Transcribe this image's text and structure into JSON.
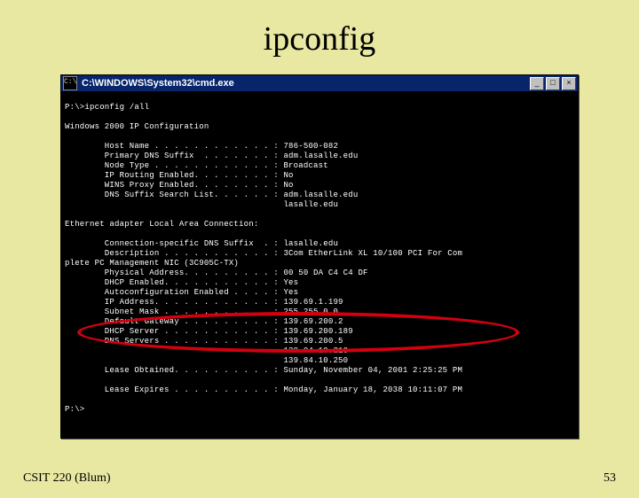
{
  "slide": {
    "title": "ipconfig",
    "footer_left": "CSIT 220 (Blum)",
    "footer_right": "53"
  },
  "window": {
    "icon_label": "C:\\",
    "title": "C:\\WINDOWS\\System32\\cmd.exe",
    "buttons": {
      "min": "_",
      "max": "□",
      "close": "×"
    }
  },
  "terminal": {
    "prompt1": "P:\\>ipconfig /all",
    "blank": "",
    "header": "Windows 2000 IP Configuration",
    "host_name": "        Host Name . . . . . . . . . . . . : 786-500-082",
    "primary_dns": "        Primary DNS Suffix  . . . . . . . : adm.lasalle.edu",
    "node_type": "        Node Type . . . . . . . . . . . . : Broadcast",
    "ip_routing": "        IP Routing Enabled. . . . . . . . : No",
    "wins_proxy": "        WINS Proxy Enabled. . . . . . . . : No",
    "dns_search": "        DNS Suffix Search List. . . . . . : adm.lasalle.edu",
    "dns_search2": "                                            lasalle.edu",
    "adapter_header": "Ethernet adapter Local Area Connection:",
    "conn_dns": "        Connection-specific DNS Suffix  . : lasalle.edu",
    "description": "        Description . . . . . . . . . . . : 3Com EtherLink XL 10/100 PCI For Com",
    "desc_wrap": "plete PC Management NIC (3C905C-TX)",
    "phys_addr": "        Physical Address. . . . . . . . . : 00 50 DA C4 C4 DF",
    "dhcp_enabled": "        DHCP Enabled. . . . . . . . . . . : Yes",
    "autoconf": "        Autoconfiguration Enabled . . . . : Yes",
    "ip_address": "        IP Address. . . . . . . . . . . . : 139.69.1.199",
    "subnet": "        Subnet Mask . . . . . . . . . . . : 255.255.0.0",
    "gateway": "        Default Gateway . . . . . . . . . : 139.69.200.2",
    "dhcp_server": "        DHCP Server . . . . . . . . . . . : 139.69.200.189",
    "dns_servers": "        DNS Servers . . . . . . . . . . . : 139.69.200.5",
    "dns2": "                                            139.84.10.210",
    "dns3": "                                            139.84.10.250",
    "lease_obt": "        Lease Obtained. . . . . . . . . . : Sunday, November 04, 2001 2:25:25 PM",
    "lease_exp": "        Lease Expires . . . . . . . . . . : Monday, January 18, 2038 10:11:07 PM",
    "prompt2": "P:\\>"
  },
  "highlight": {
    "color": "#d40010"
  }
}
